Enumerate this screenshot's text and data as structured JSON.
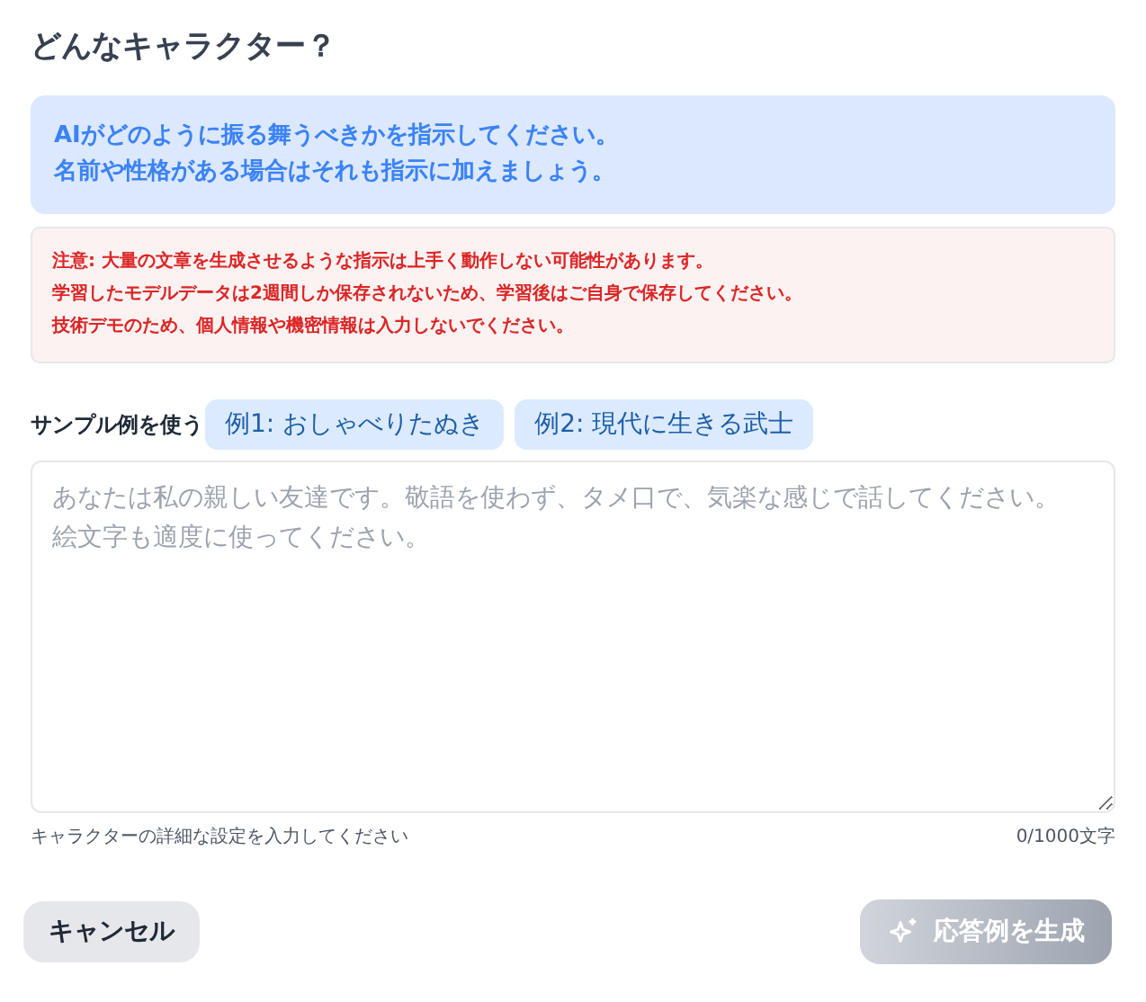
{
  "title": "どんなキャラクター？",
  "info": [
    "AIがどのように振る舞うべきかを指示してください。",
    "名前や性格がある場合はそれも指示に加えましょう。"
  ],
  "warning": [
    "注意: 大量の文章を生成させるような指示は上手く動作しない可能性があります。",
    "学習したモデルデータは2週間しか保存されないため、学習後はご自身で保存してください。",
    "技術デモのため、個人情報や機密情報は入力しないでください。"
  ],
  "samples": {
    "label": "サンプル例を使う",
    "chips": [
      "例1: おしゃべりたぬき",
      "例2: 現代に生きる武士"
    ]
  },
  "textarea": {
    "placeholder": "あなたは私の親しい友達です。敬語を使わず、タメ口で、気楽な感じで話してください。絵文字も適度に使ってください。",
    "hint": "キャラクターの詳細な設定を入力してください",
    "counter": "0/1000文字"
  },
  "buttons": {
    "cancel": {
      "label": "キャンセル"
    },
    "generate": {
      "label": "応答例を生成",
      "disabled": true
    }
  }
}
